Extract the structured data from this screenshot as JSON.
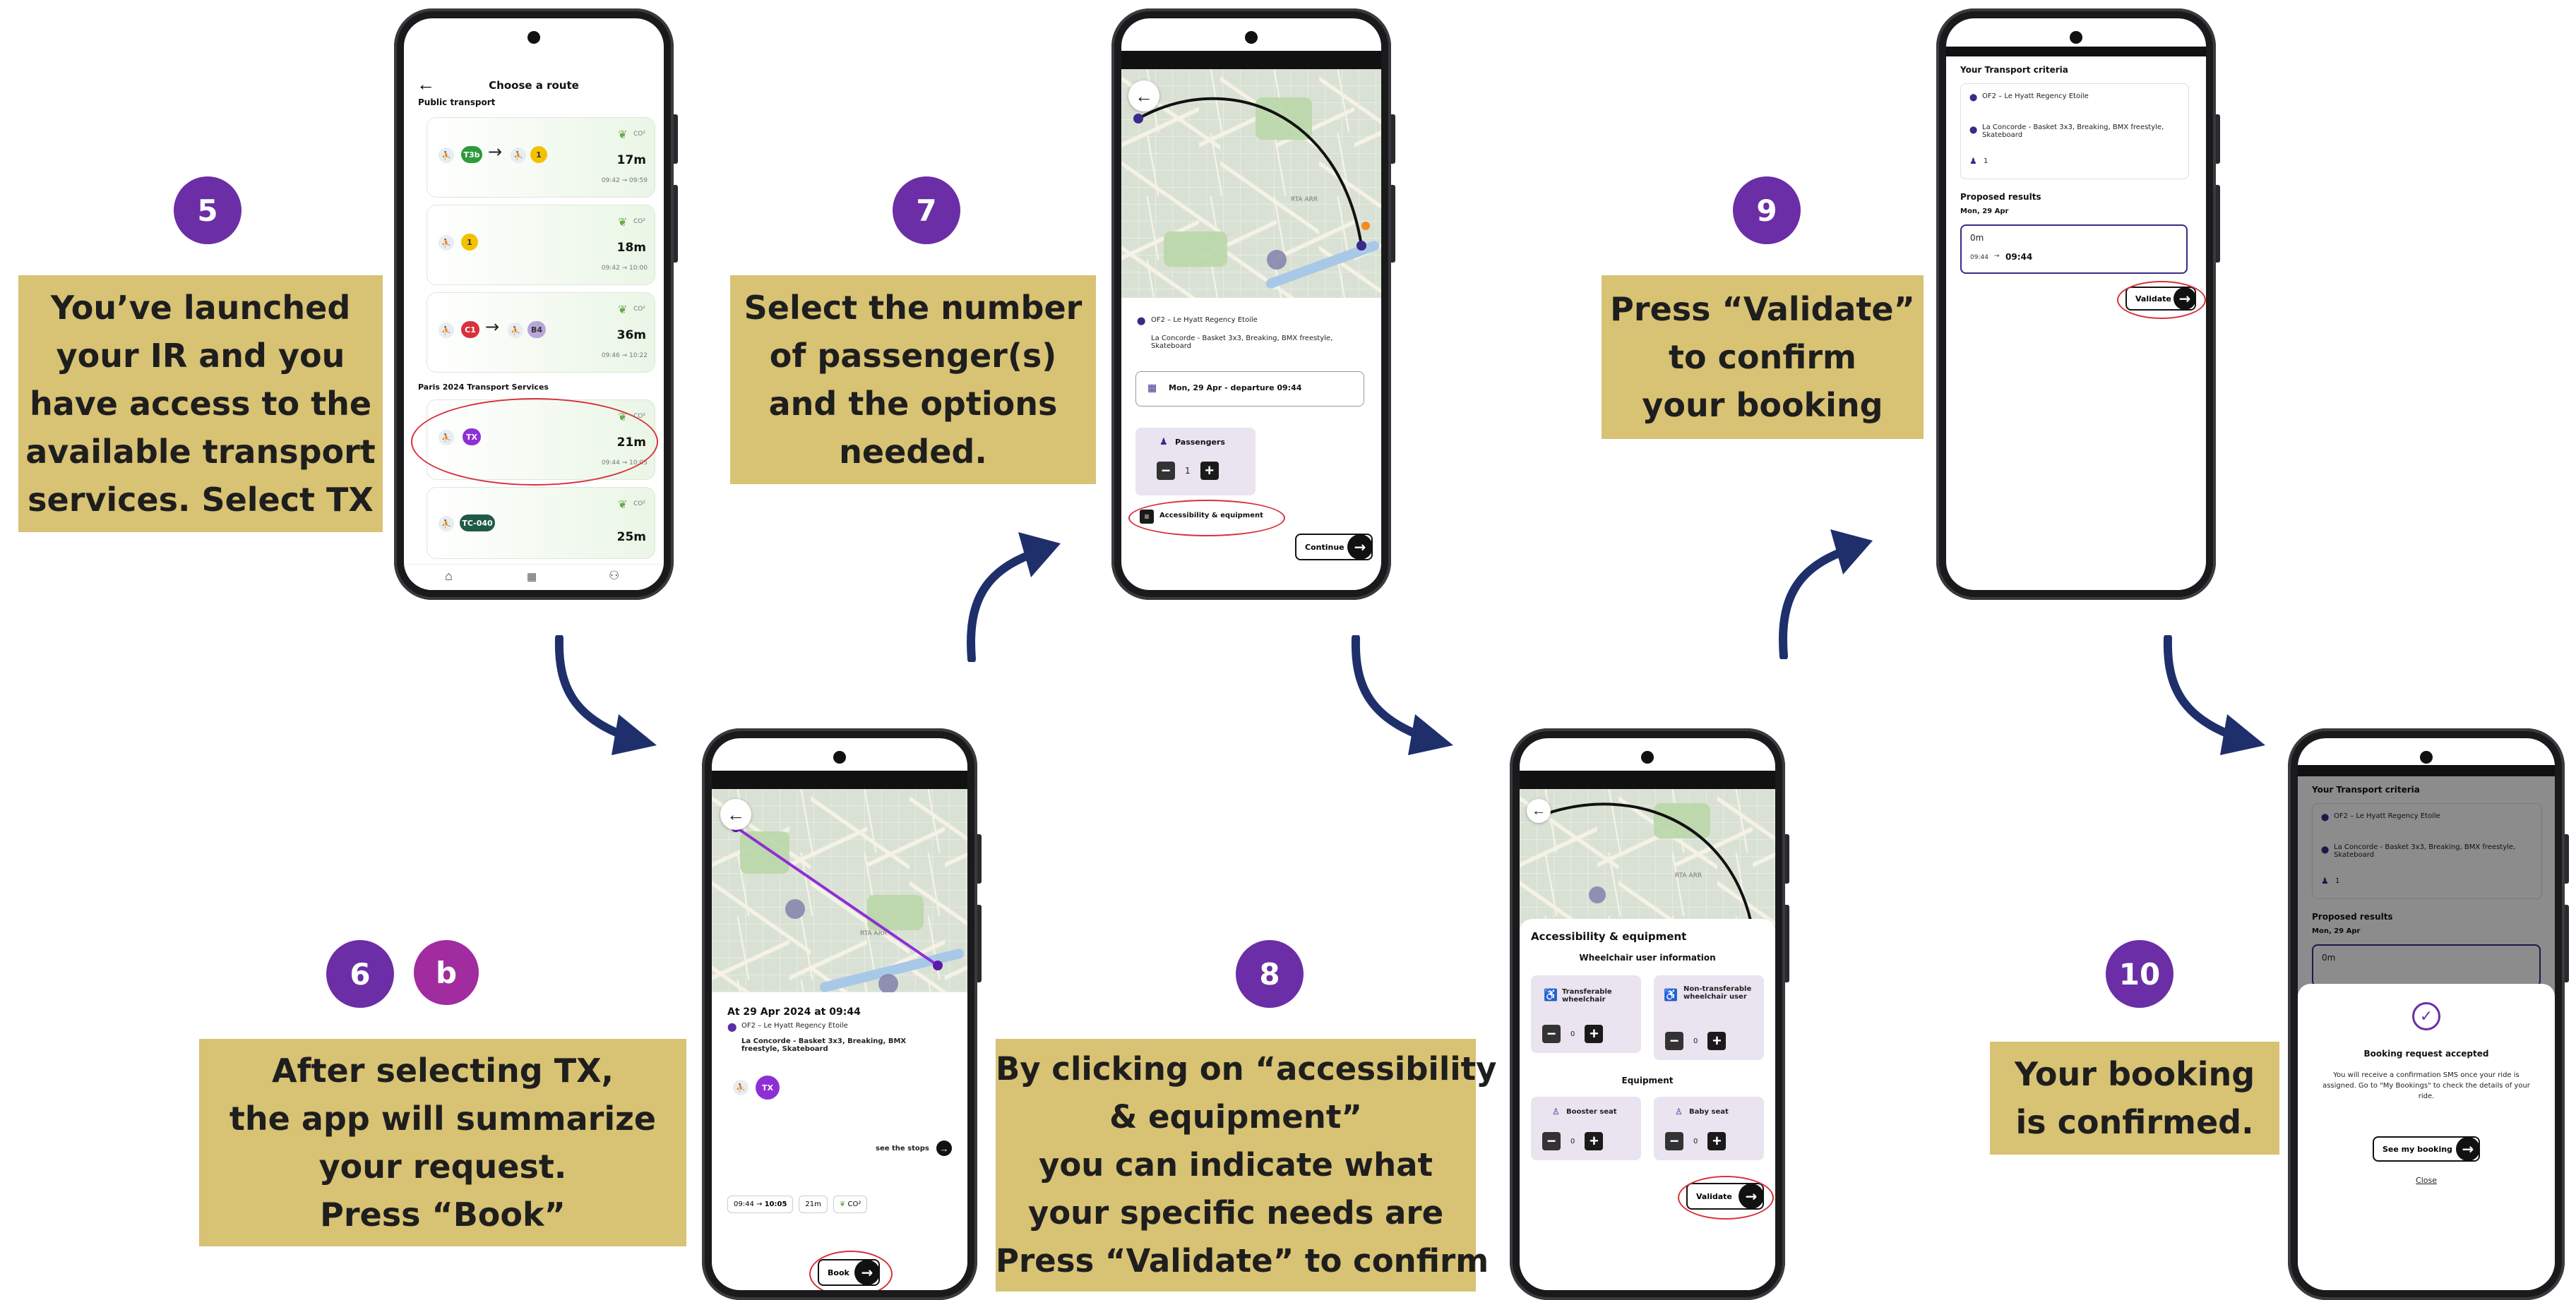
{
  "steps": [
    {
      "num": "5",
      "caption": [
        "You’ve launched",
        "your IR and you",
        "have access to the",
        "available transport",
        "services. Select TX"
      ]
    },
    {
      "num": "6",
      "sub": "b",
      "caption": [
        "After selecting TX,",
        "the app will summarize",
        "your request.",
        "Press “Book”"
      ]
    },
    {
      "num": "7",
      "caption": [
        "Select the number",
        "of passenger(s)",
        "and the options",
        "needed."
      ]
    },
    {
      "num": "8",
      "caption": [
        "By clicking on “accessibility",
        "& equipment”",
        "you can indicate what",
        "your specific needs are",
        "Press “Validate” to confirm"
      ]
    },
    {
      "num": "9",
      "caption": [
        "Press “Validate”",
        "to confirm",
        "your booking"
      ]
    },
    {
      "num": "10",
      "caption": [
        "Your booking",
        "is confirmed."
      ]
    }
  ],
  "screen5": {
    "title": "Choose a route",
    "section_public": "Public transport",
    "section_paris": "Paris 2024 Transport Services",
    "routes": [
      {
        "line1": "T3b",
        "line2": "1",
        "mins": "17m",
        "times": "09:42 → 09:59",
        "co2": "CO²"
      },
      {
        "line1": "1",
        "mins": "18m",
        "times": "09:42 → 10:00",
        "co2": "CO²"
      },
      {
        "line1": "C1",
        "line2": "B4",
        "mins": "36m",
        "times": "09:46 → 10:22",
        "co2": "CO²"
      },
      {
        "line1": "TX",
        "mins": "21m",
        "times": "09:44 → 10:05",
        "co2": "CO²"
      },
      {
        "line1": "TC-040",
        "mins": "25m",
        "co2": "CO²"
      }
    ],
    "nav": [
      "home-icon",
      "calendar-icon",
      "user-icon"
    ]
  },
  "screen6": {
    "map_label": "RTA ARR",
    "when": "At  29 Apr 2024 at 09:44",
    "from": "OF2 – Le Hyatt Regency Etoile",
    "to": "La Concorde - Basket 3x3, Breaking, BMX freestyle, Skateboard",
    "line": "TX",
    "see_stops": "see the stops",
    "dep": "09:44",
    "arr": "10:05",
    "dur": "21m",
    "co2": "CO²",
    "book": "Book"
  },
  "screen7": {
    "map_label": "RTA ARR",
    "from": "OF2 – Le Hyatt Regency Etoile",
    "to": "La Concorde - Basket 3x3, Breaking, BMX freestyle, Skateboard",
    "date": "Mon, 29 Apr - departure 09:44",
    "passengers_label": "Passengers",
    "passengers_value": "1",
    "access": "Accessibility & equipment",
    "continue": "Continue"
  },
  "screen8": {
    "map_label": "RTA ARR",
    "sheet_title": "Accessibility & equipment",
    "wheelchair_title": "Wheelchair user information",
    "transferable": "Transferable wheelchair",
    "non_transferable": "Non-transferable wheelchair user",
    "equipment_title": "Equipment",
    "booster": "Booster seat",
    "baby": "Baby seat",
    "count": "0",
    "validate": "Validate"
  },
  "screen9": {
    "criteria_title": "Your Transport criteria",
    "from": "OF2 – Le Hyatt Regency Etoile",
    "to": "La Concorde - Basket 3x3, Breaking, BMX freestyle, Skateboard",
    "pax": "1",
    "results_title": "Proposed results",
    "date": "Mon, 29 Apr",
    "result_mins": "0m",
    "result_dep": "09:44",
    "result_arr": "09:44",
    "validate": "Validate"
  },
  "screen10": {
    "criteria_title": "Your Transport criteria",
    "from": "OF2 – Le Hyatt Regency Etoile",
    "to": "La Concorde - Basket 3x3, Breaking, BMX freestyle, Skateboard",
    "pax": "1",
    "results_title": "Proposed results",
    "date": "Mon, 29 Apr",
    "result_mins": "0m",
    "modal_title": "Booking request accepted",
    "modal_text": "You will receive a confirmation SMS once your ride is assigned. Go to \"My Bookings\" to check the details of your ride.",
    "see_bookings": "See my booking",
    "close": "Close"
  },
  "colors": {
    "step": "#6b2ea6",
    "step_b": "#a02ca0",
    "caption_bg": "#d8c273",
    "arrow": "#1f2f6b",
    "tx": "#8e2fd6",
    "ring": "#d8313c"
  }
}
